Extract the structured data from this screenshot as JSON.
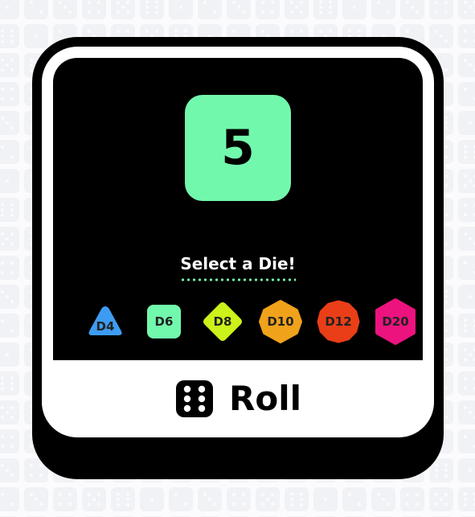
{
  "result": {
    "value": "5",
    "color": "#72f8ad"
  },
  "prompt": {
    "label": "Select a Die!",
    "underline_color": "#72f8ad"
  },
  "dice": [
    {
      "label": "D4",
      "shape": "triangle",
      "color": "#3d9cf2"
    },
    {
      "label": "D6",
      "shape": "rounded-square",
      "color": "#72f8ad"
    },
    {
      "label": "D8",
      "shape": "diamond",
      "color": "#cbf21a"
    },
    {
      "label": "D10",
      "shape": "octagon",
      "color": "#f0a21b"
    },
    {
      "label": "D12",
      "shape": "dodecagon",
      "color": "#ea3e18"
    },
    {
      "label": "D20",
      "shape": "hexagon",
      "color": "#ec137e"
    }
  ],
  "roll_button": {
    "label": "Roll",
    "icon": "dice-six-icon"
  }
}
